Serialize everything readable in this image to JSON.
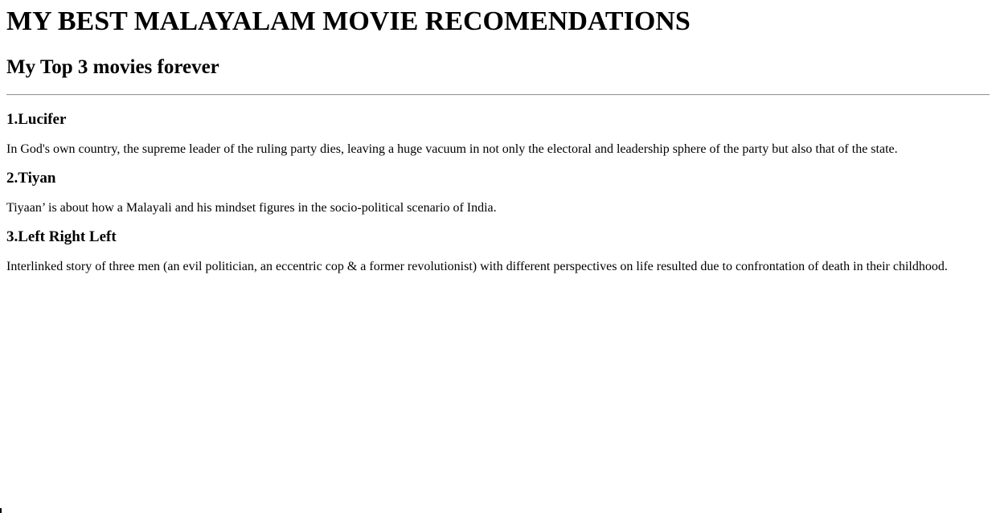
{
  "page": {
    "title": "MY BEST MALAYALAM MOVIE RECOMENDATIONS",
    "subtitle": "My Top 3 movies forever"
  },
  "movies": [
    {
      "heading": "1.Lucifer",
      "description": "In God's own country, the supreme leader of the ruling party dies, leaving a huge vacuum in not only the electoral and leadership sphere of the party but also that of the state."
    },
    {
      "heading": "2.Tiyan",
      "description": "Tiyaan’ is about how a Malayali and his mindset figures in the socio-political scenario of India."
    },
    {
      "heading": "3.Left Right Left",
      "description": "Interlinked story of three men (an evil politician, an eccentric cop & a former revolutionist) with different perspectives on life resulted due to confrontation of death in their childhood."
    }
  ]
}
